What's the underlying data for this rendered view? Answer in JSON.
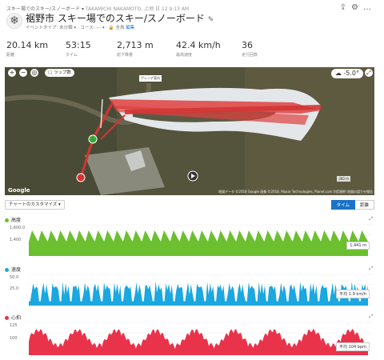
{
  "header": {
    "breadcrumb": "スキー場でのスキー/スノーボード",
    "user": "TAKAMICHI NAKAMOTO, 上地 日 12 9:13 AM",
    "title": "裾野市 スキー場でのスキー/スノーボード",
    "event_type": "イベントタイプ: 未分類",
    "course": "コース: ---",
    "privacy": "全員",
    "edit_link": "編集"
  },
  "stats": [
    {
      "value": "20.14 km",
      "label": "距離"
    },
    {
      "value": "53:15",
      "label": "タイム"
    },
    {
      "value": "2,713 m",
      "label": "総下降量"
    },
    {
      "value": "42.4 km/h",
      "label": "最高速度"
    },
    {
      "value": "36",
      "label": "走行回数"
    }
  ],
  "map": {
    "layer_toggle": "ラップ数",
    "temperature": "-5.0°",
    "google": "Google",
    "attribution": "地図データ ©2018 Google 画像 ©2018, Maxar Technologies, Planet.com   利用規約   地図の誤りを報告",
    "scale": "300 m",
    "sign": "ゲレンデ案内"
  },
  "controls": {
    "customize": "チャートのカスタマイズ",
    "tab_time": "タイム",
    "tab_distance": "距離"
  },
  "charts": [
    {
      "title": "高度",
      "y_top": "1,600.0",
      "y_mid": "1,400",
      "readout": "1,441 m",
      "color": "#6cbf2f"
    },
    {
      "title": "速度",
      "y_top": "50.0",
      "y_mid": "25.0",
      "readout": "平均 1.9 km/h",
      "color": "#1ba7e0"
    },
    {
      "title": "心拍",
      "y_top": "125",
      "y_mid": "100",
      "readout": "平均 104 bpm",
      "color": "#e8334a"
    }
  ],
  "chart_data": [
    {
      "type": "area",
      "title": "高度",
      "ylim": [
        1200,
        1600
      ],
      "runs": 36,
      "series": [
        {
          "name": "高度",
          "values": [
            1300,
            1400,
            1300,
            1400,
            1300,
            1400,
            1300,
            1400,
            1300,
            1400,
            1300,
            1400,
            1300,
            1400,
            1300,
            1400,
            1300,
            1400,
            1300,
            1400,
            1300,
            1400,
            1300,
            1400,
            1300,
            1400,
            1300,
            1400,
            1300,
            1400,
            1300,
            1400,
            1300,
            1400,
            1300,
            1400,
            1300,
            1400,
            1300,
            1400,
            1300,
            1400,
            1300,
            1400,
            1300,
            1400,
            1300,
            1400,
            1300,
            1400,
            1300,
            1400,
            1300,
            1400,
            1300,
            1400,
            1300,
            1400,
            1300,
            1400,
            1300,
            1400,
            1300,
            1400,
            1300,
            1400,
            1300,
            1400,
            1300,
            1400,
            1300,
            1400
          ]
        }
      ]
    },
    {
      "type": "area",
      "title": "速度",
      "ylim": [
        0,
        50
      ]
    },
    {
      "type": "area",
      "title": "心拍",
      "ylim": [
        75,
        125
      ]
    }
  ]
}
